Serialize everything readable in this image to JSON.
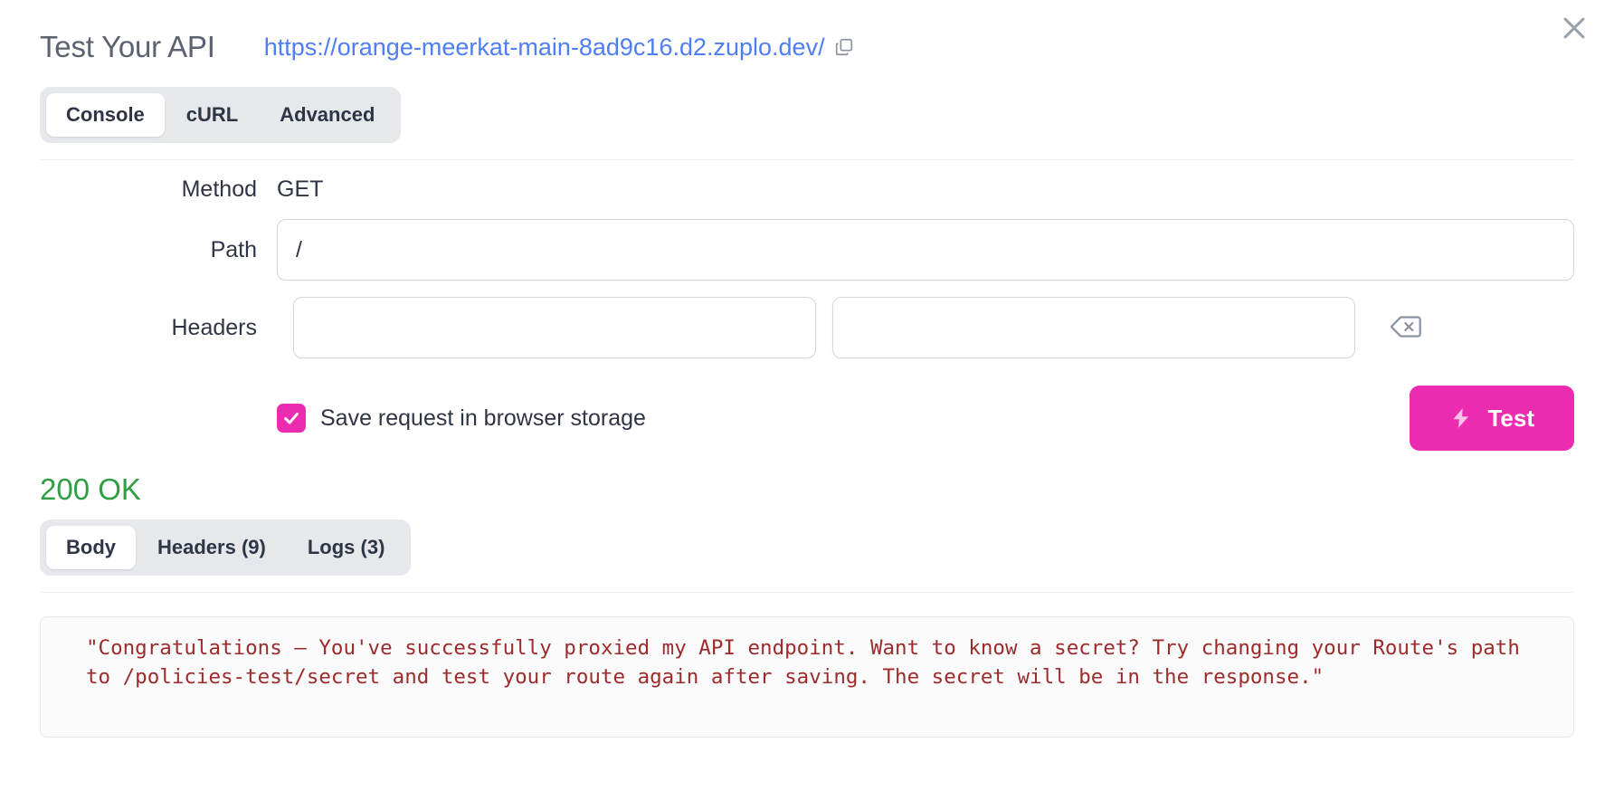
{
  "header": {
    "title": "Test Your API",
    "url": "https://orange-meerkat-main-8ad9c16.d2.zuplo.dev/",
    "copy_icon": "copy-icon",
    "close_icon": "close-icon"
  },
  "request_tabs": {
    "items": [
      {
        "label": "Console",
        "active": true
      },
      {
        "label": "cURL",
        "active": false
      },
      {
        "label": "Advanced",
        "active": false
      }
    ]
  },
  "form": {
    "method_label": "Method",
    "method_value": "GET",
    "path_label": "Path",
    "path_value": "/",
    "path_placeholder": "",
    "headers_label": "Headers",
    "header_name_value": "",
    "header_name_placeholder": "",
    "header_value_value": "",
    "header_value_placeholder": "",
    "delete_header_icon": "backspace-delete-icon"
  },
  "actions": {
    "save_checkbox_label": "Save request in browser storage",
    "save_checkbox_checked": true,
    "test_button_label": "Test",
    "test_button_icon": "lightning-bolt-icon"
  },
  "response": {
    "status_text": "200 OK",
    "tabs": [
      {
        "label": "Body",
        "active": true
      },
      {
        "label": "Headers (9)",
        "active": false
      },
      {
        "label": "Logs (3)",
        "active": false
      }
    ],
    "body_text": "\"Congratulations — You've successfully proxied my API endpoint. Want to know a secret? Try changing your Route's path to /policies-test/secret and test your route again after saving. The secret will be in the response.\""
  },
  "colors": {
    "accent_pink": "#ec2bb0",
    "link_blue": "#4f7df3",
    "status_green": "#2f9e44",
    "body_text_red": "#9e2b2b",
    "tabgroup_bg": "#e6e8ec"
  }
}
